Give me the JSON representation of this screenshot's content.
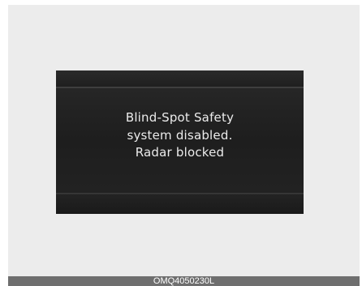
{
  "display": {
    "message_lines": [
      "Blind-Spot Safety",
      "system disabled.",
      "Radar blocked"
    ]
  },
  "figure": {
    "code": "OMQ4050230L"
  },
  "colors": {
    "background": "#ececec",
    "display_background": "#1c1c1c",
    "text": "#ebebeb",
    "caption_bar": "#6e6e6e"
  }
}
